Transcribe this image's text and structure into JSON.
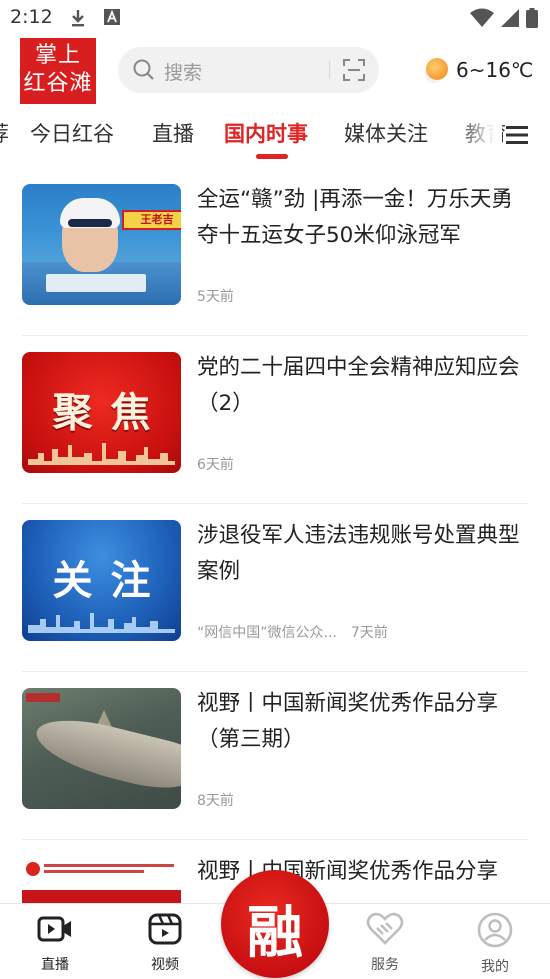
{
  "status_bar": {
    "time": "2:12"
  },
  "header": {
    "logo_text_line1": "掌上",
    "logo_text_line2": "红谷滩",
    "search_placeholder": "搜索",
    "weather_temp": "6~16℃"
  },
  "tabs": [
    {
      "label": "荐"
    },
    {
      "label": "今日红谷"
    },
    {
      "label": "直播"
    },
    {
      "label": "国内时事"
    },
    {
      "label": "媒体关注"
    },
    {
      "label": "教育"
    }
  ],
  "active_tab": "国内时事",
  "news": [
    {
      "title": "全运“赣”劲 |再添一金！万乐天勇夺十五运女子50米仰泳冠军",
      "source": "",
      "time": "5天前",
      "thumb": "swimming-photo",
      "thumb_banner": "王老吉"
    },
    {
      "title": "党的二十届四中全会精神应知应会（2）",
      "source": "",
      "time": "6天前",
      "thumb": "red-focus-graphic",
      "thumb_word": "聚焦"
    },
    {
      "title": "涉退役军人违法违规账号处置典型案例",
      "source": "“网信中国”微信公众...",
      "time": "7天前",
      "thumb": "blue-attention-graphic",
      "thumb_word": "关注"
    },
    {
      "title": "视野丨中国新闻奖优秀作品分享（第三期）",
      "source": "",
      "time": "8天前",
      "thumb": "fish-photo"
    },
    {
      "title": "视野丨中国新闻奖优秀作品分享",
      "source": "",
      "time": "",
      "thumb": "award-banner"
    }
  ],
  "bottom_nav": {
    "items": [
      {
        "label": "直播",
        "icon": "live-video-icon"
      },
      {
        "label": "视频",
        "icon": "video-icon"
      },
      {
        "label": "",
        "icon": "rong-center-icon",
        "glyph": "融"
      },
      {
        "label": "服务",
        "icon": "handshake-heart-icon"
      },
      {
        "label": "我的",
        "icon": "profile-icon"
      }
    ]
  },
  "colors": {
    "accent": "#e02323",
    "logo_red": "#d81e1e"
  }
}
